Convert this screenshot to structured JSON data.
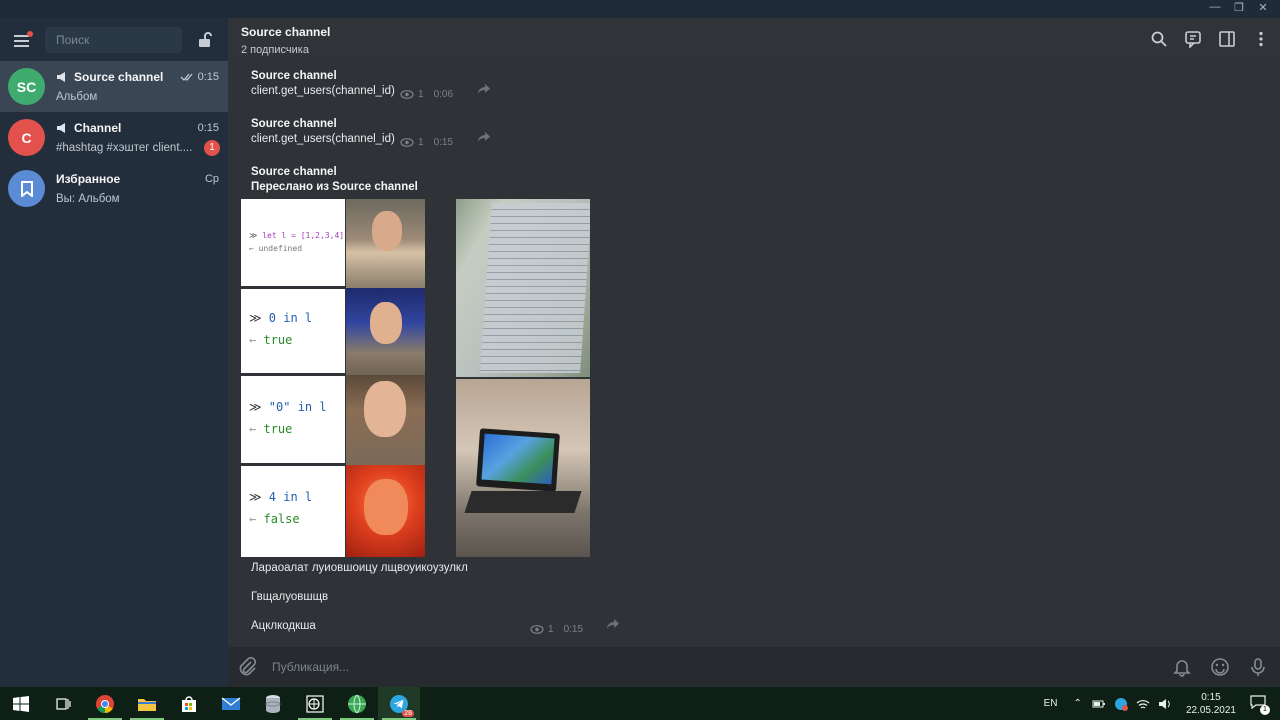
{
  "sidebar": {
    "search_placeholder": "Поиск",
    "chats": [
      {
        "initials": "SC",
        "name": "Source channel",
        "preview": "Альбом",
        "time": "0:15",
        "avatar_color": "#3fab6e"
      },
      {
        "initials": "C",
        "name": "Channel",
        "preview": "#hashtag #хэштег    client....",
        "time": "0:15",
        "unread": "1",
        "avatar_color": "#e2514c"
      },
      {
        "name": "Избранное",
        "preview": "Вы: Альбом",
        "time": "Ср",
        "avatar_color": "#5b8bd4"
      }
    ]
  },
  "header": {
    "title": "Source channel",
    "subtitle": "2 подписчика"
  },
  "messages": [
    {
      "from": "Source channel",
      "text": "client.get_users(channel_id)",
      "views": "1",
      "time": "0:06"
    },
    {
      "from": "Source channel",
      "text": "client.get_users(channel_id)",
      "views": "1",
      "time": "0:15"
    },
    {
      "from": "Source channel",
      "forwarded": "Переслано из Source channel",
      "album": {
        "code_rows": [
          {
            "expr": "let l = [1,2,3,4]",
            "result": "undefined"
          },
          {
            "expr": "0 in l",
            "result": "true"
          },
          {
            "expr": "\"0\" in l",
            "result": "true"
          },
          {
            "expr": "4 in l",
            "result": "false"
          }
        ]
      },
      "caption": [
        "Лараоалат луиовшоицу лщвоуикоузулкл",
        "Гвщалуовшщв",
        "Ацклкодкша"
      ],
      "views": "1",
      "time": "0:15"
    }
  ],
  "composer": {
    "placeholder": "Публикация..."
  },
  "taskbar": {
    "lang": "EN",
    "clock_time": "0:15",
    "clock_date": "22.05.2021",
    "telegram_badge": "28",
    "notification_count": "1"
  },
  "colors": {
    "sidebar_bg": "#232e3c",
    "chat_bg": "#2f3337",
    "accent_green": "#3fab6e",
    "unread_red": "#e2514c"
  }
}
